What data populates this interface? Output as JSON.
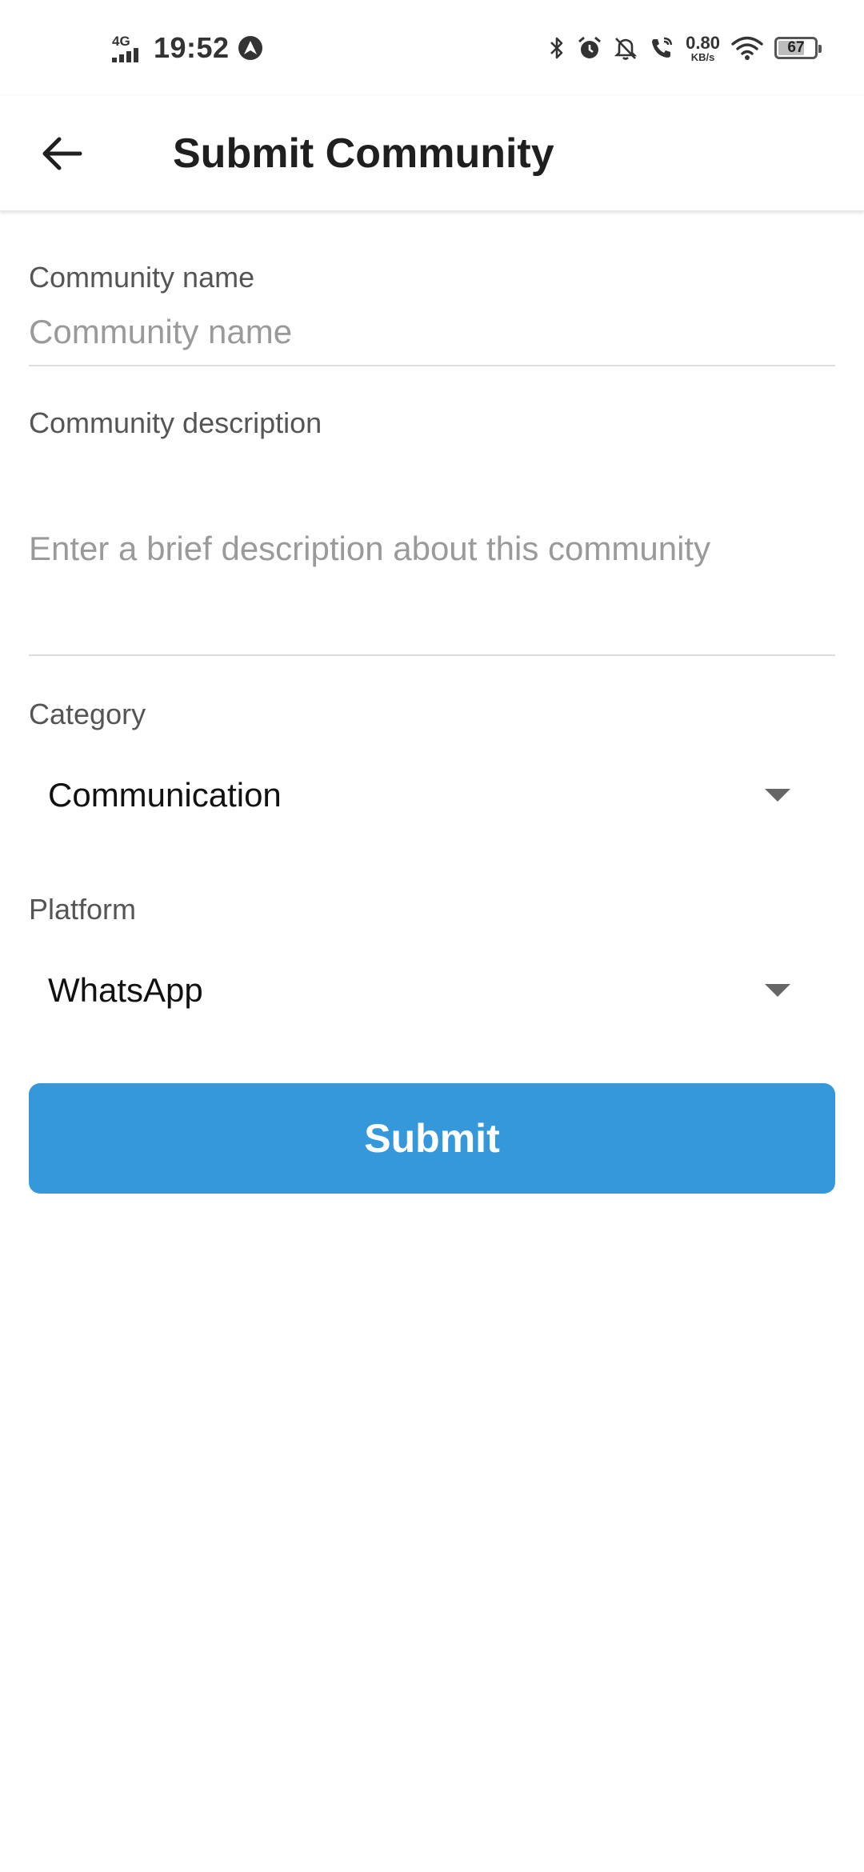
{
  "status_bar": {
    "network_type": "4G",
    "time": "19:52",
    "speed_value": "0.80",
    "speed_unit": "KB/s",
    "battery_level": "67",
    "icons": [
      "signal-icon",
      "nav-app-icon",
      "bluetooth-icon",
      "alarm-icon",
      "bell-off-icon",
      "wifi-call-icon",
      "wifi-icon",
      "battery-icon"
    ]
  },
  "app_bar": {
    "title": "Submit Community",
    "back_icon": "arrow-left-icon"
  },
  "form": {
    "name": {
      "label": "Community name",
      "value": "",
      "placeholder": "Community name"
    },
    "description": {
      "label": "Community description",
      "value": "",
      "placeholder": "Enter a brief description about this community"
    },
    "category": {
      "label": "Category",
      "selected": "Communication"
    },
    "platform": {
      "label": "Platform",
      "selected": "WhatsApp"
    },
    "submit_label": "Submit"
  },
  "colors": {
    "accent": "#3498db",
    "label": "#555555",
    "placeholder": "#9a9a9a",
    "divider": "#dddddd"
  }
}
